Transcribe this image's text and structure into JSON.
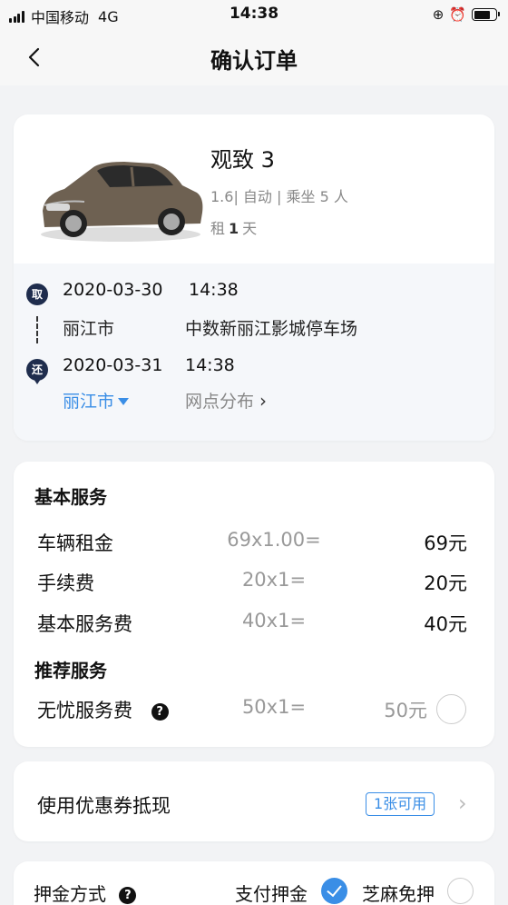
{
  "status_bar": {
    "carrier": "中国移动",
    "network": "4G",
    "time": "14:38"
  },
  "nav": {
    "title": "确认订单"
  },
  "car": {
    "name": "观致 3",
    "spec": "1.6| 自动 | 乘坐 5 人",
    "days_prefix": "租",
    "days": "1",
    "days_suffix": "天"
  },
  "pickup": {
    "badge": "取",
    "date": "2020-03-30",
    "time": "14:38",
    "city": "丽江市",
    "place": "中数新丽江影城停车场"
  },
  "return": {
    "badge": "还",
    "date": "2020-03-31",
    "time": "14:38",
    "city": "丽江市",
    "outlets": "网点分布"
  },
  "fees": {
    "basic_title": "基本服务",
    "items": [
      {
        "label": "车辆租金",
        "formula": "69x1.00=",
        "amount": "69元"
      },
      {
        "label": "手续费",
        "formula": "20x1=",
        "amount": "20元"
      },
      {
        "label": "基本服务费",
        "formula": "40x1=",
        "amount": "40元"
      }
    ],
    "recommended_title": "推荐服务",
    "recommended": {
      "label": "无忧服务费",
      "formula": "50x1=",
      "amount": "50元",
      "selected": false
    }
  },
  "coupon": {
    "label": "使用优惠券抵现",
    "badge": "1张可用"
  },
  "deposit": {
    "label": "押金方式",
    "option_pay": "支付押金",
    "option_pay_selected": true,
    "option_zhima": "芝麻免押",
    "option_zhima_selected": false
  },
  "colors": {
    "accent": "#3a8ee6",
    "pin": "#1f2d4d",
    "background": "#f2f3f5"
  }
}
